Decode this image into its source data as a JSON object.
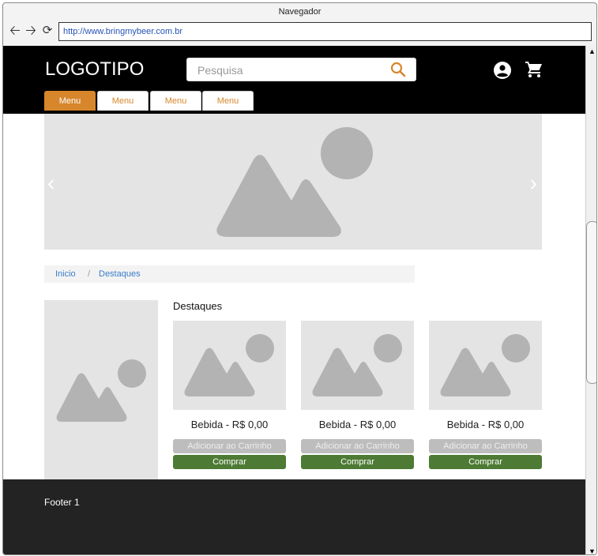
{
  "browser": {
    "title": "Navegador",
    "url": "http://www.bringmybeer.com.br",
    "back_icon": "arrow-left",
    "forward_icon": "arrow-right",
    "reload_icon": "reload"
  },
  "header": {
    "logo": "LOGOTIPO",
    "search_placeholder": "Pesquisa",
    "search_icon": "search",
    "user_icon": "user-circle",
    "cart_icon": "shopping-cart"
  },
  "menu": {
    "tabs": [
      {
        "label": "Menu",
        "active": true
      },
      {
        "label": "Menu",
        "active": false
      },
      {
        "label": "Menu",
        "active": false
      },
      {
        "label": "Menu",
        "active": false
      }
    ]
  },
  "banner": {
    "prev": "‹",
    "next": "›"
  },
  "breadcrumb": {
    "items": [
      "Inicio",
      "Destaques"
    ],
    "separator": "/"
  },
  "section": {
    "title": "Destaques"
  },
  "products": [
    {
      "name": "Bebida - R$ 0,00",
      "add_label": "Adicionar ao Carrinho",
      "buy_label": "Comprar"
    },
    {
      "name": "Bebida - R$ 0,00",
      "add_label": "Adicionar ao Carrinho",
      "buy_label": "Comprar"
    },
    {
      "name": "Bebida - R$ 0,00",
      "add_label": "Adicionar ao Carrinho",
      "buy_label": "Comprar"
    }
  ],
  "footer": {
    "label": "Footer 1"
  },
  "colors": {
    "accent": "#d7862c",
    "buy": "#4d7a34",
    "header_bg": "#000000",
    "footer_bg": "#232323"
  }
}
